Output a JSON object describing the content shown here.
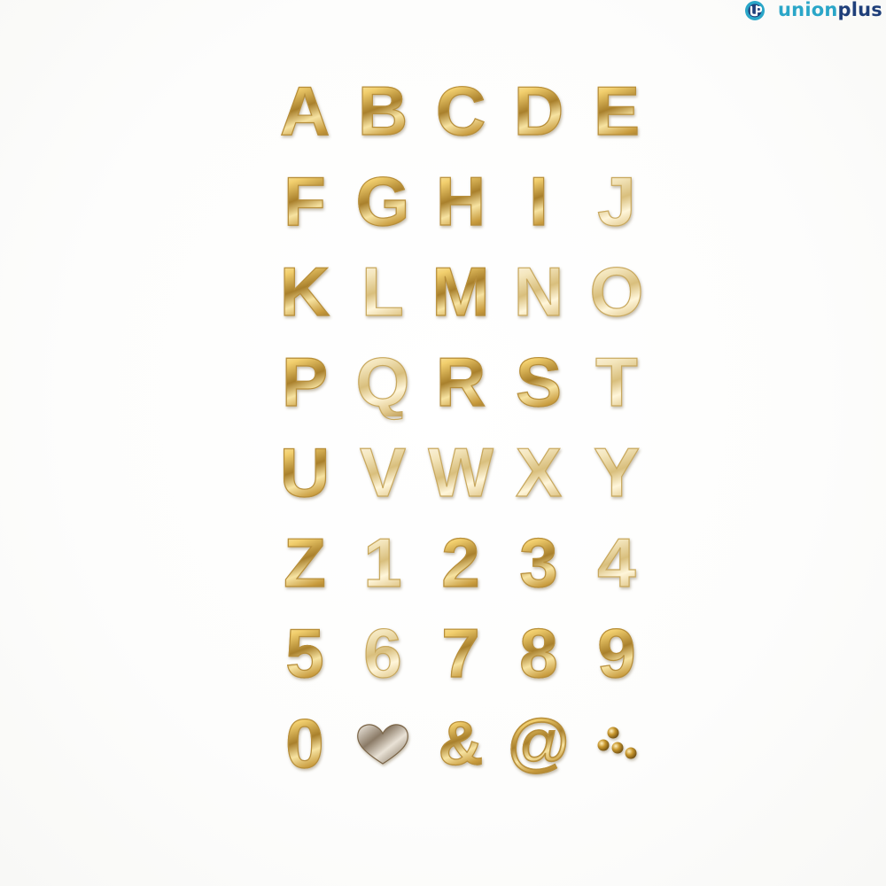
{
  "logo": {
    "word_union": "union",
    "word_plus": "plus",
    "icon": "unionplus-logo-icon",
    "colors": {
      "teal": "#2aa6c8",
      "navy": "#1f3f7a"
    }
  },
  "glyph_color": "#d7b35a",
  "glyphs": [
    "A",
    "B",
    "C",
    "D",
    "E",
    "F",
    "G",
    "H",
    "I",
    "J",
    "K",
    "L",
    "M",
    "N",
    "O",
    "P",
    "Q",
    "R",
    "S",
    "T",
    "U",
    "V",
    "W",
    "X",
    "Y",
    "Z",
    "1",
    "2",
    "3",
    "4",
    "5",
    "6",
    "7",
    "8",
    "9",
    "0",
    "",
    "&",
    "@",
    ""
  ],
  "shapes": {
    "heart": "heart-icon",
    "dots": "three-dots-icon"
  }
}
